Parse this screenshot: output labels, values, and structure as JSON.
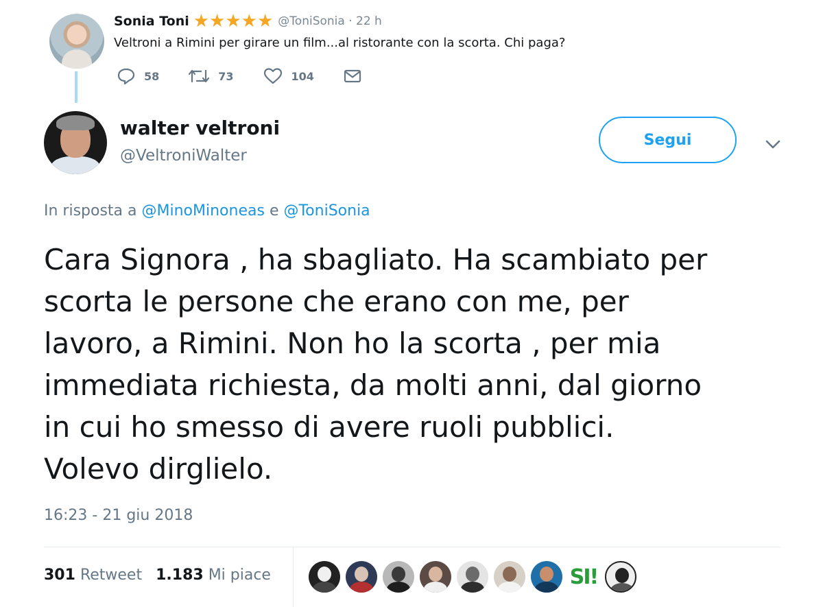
{
  "parent_tweet": {
    "author_name": "Sonia Toni",
    "stars": "★★★★★",
    "handle_time": "@ToniSonia · 22 h",
    "text": "Veltroni a Rimini per girare un film...al ristorante con la scorta. Chi paga?",
    "actions": {
      "reply_count": "58",
      "retweet_count": "73",
      "like_count": "104"
    }
  },
  "tweet": {
    "author_name": "walter veltroni",
    "handle": "@VeltroniWalter",
    "follow_label": "Segui",
    "reply_prefix": "In risposta a",
    "reply_mention_1": "@MinoMinoneas",
    "reply_conjunction": "e",
    "reply_mention_2": "@ToniSonia",
    "text_lines": [
      "Cara Signora , ha sbagliato. Ha scambiato per",
      "scorta le persone che erano con me, per",
      "lavoro, a Rimini. Non ho la scorta , per mia",
      "immediata richiesta, da molti anni, dal giorno",
      "in cui ho smesso di avere ruoli pubblici.",
      "Volevo dirglielo."
    ],
    "timestamp": "16:23 - 21 giu 2018"
  },
  "stats": {
    "retweet_count": "301",
    "retweet_label": "Retweet",
    "like_count": "1.183",
    "like_label": "Mi piace"
  },
  "likers_avatar_9_text": "SI!",
  "colors": {
    "accent": "#1da1f2",
    "mention": "#1b95e0",
    "muted": "#657786",
    "star": "#f5a623",
    "thread_line": "#a9d9f5"
  }
}
